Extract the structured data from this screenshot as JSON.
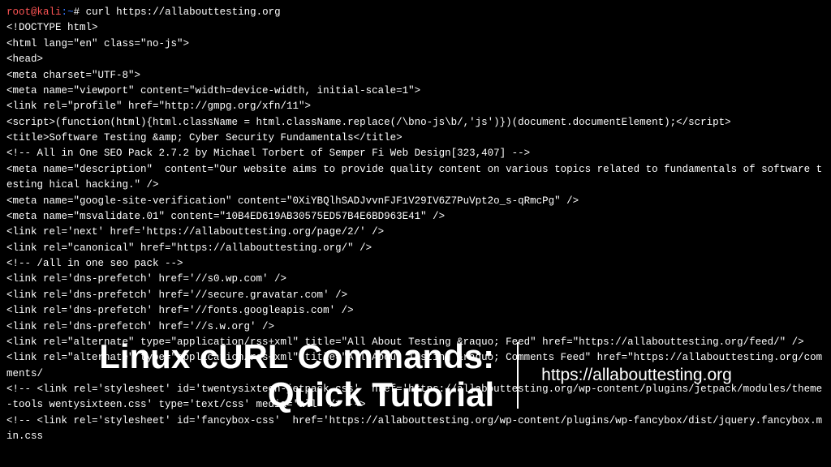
{
  "prompt": {
    "user": "root",
    "at": "@",
    "host": "kali",
    "colon": ":",
    "path": "~",
    "hash": "#",
    "command": "curl https://allabouttesting.org"
  },
  "output": [
    "<!DOCTYPE html>",
    "<html lang=\"en\" class=\"no-js\">",
    "<head>",
    "<meta charset=\"UTF-8\">",
    "<meta name=\"viewport\" content=\"width=device-width, initial-scale=1\">",
    "<link rel=\"profile\" href=\"http://gmpg.org/xfn/11\">",
    "<script>(function(html){html.className = html.className.replace(/\\bno-js\\b/,'js')})(document.documentElement);</script>",
    "<title>Software Testing &amp; Cyber Security Fundamentals</title>",
    "<!-- All in One SEO Pack 2.7.2 by Michael Torbert of Semper Fi Web Design[323,407] -->",
    "<meta name=\"description\"  content=\"Our website aims to provide quality content on various topics related to fundamentals of software testing hical hacking.\" />",
    "<meta name=\"google-site-verification\" content=\"0XiYBQlhSADJvvnFJF1V29IV6Z7PuVpt2o_s-qRmcPg\" />",
    "<meta name=\"msvalidate.01\" content=\"10B4ED619AB30575ED57B4E6BD963E41\" />",
    "<link rel='next' href='https://allabouttesting.org/page/2/' />",
    "<link rel=\"canonical\" href=\"https://allabouttesting.org/\" />",
    "<!-- /all in one seo pack -->",
    "<link rel='dns-prefetch' href='//s0.wp.com' />",
    "<link rel='dns-prefetch' href='//secure.gravatar.com' />",
    "<link rel='dns-prefetch' href='//fonts.googleapis.com' />",
    "<link rel='dns-prefetch' href='//s.w.org' />",
    "<link rel=\"alternate\" type=\"application/rss+xml\" title=\"All About Testing &raquo; Feed\" href=\"https://allabouttesting.org/feed/\" />",
    "<link rel=\"alternate\" type=\"application/rss+xml\" title=\"All About Testing &raquo; Comments Feed\" href=\"https://allabouttesting.org/comments/",
    "<!-- <link rel='stylesheet' id='twentysixteen-jetpack-css'  href='https://allabouttesting.org/wp-content/plugins/jetpack/modules/theme-tools wentysixteen.css' type='text/css' media='all' /> -->",
    "<!-- <link rel='stylesheet' id='fancybox-css'  href='https://allabouttesting.org/wp-content/plugins/wp-fancybox/dist/jquery.fancybox.min.css"
  ],
  "overlay": {
    "title_line1": "Linux cURL Commands:",
    "title_line2": "Quick Tutorial",
    "url": "https://allabouttesting.org"
  }
}
